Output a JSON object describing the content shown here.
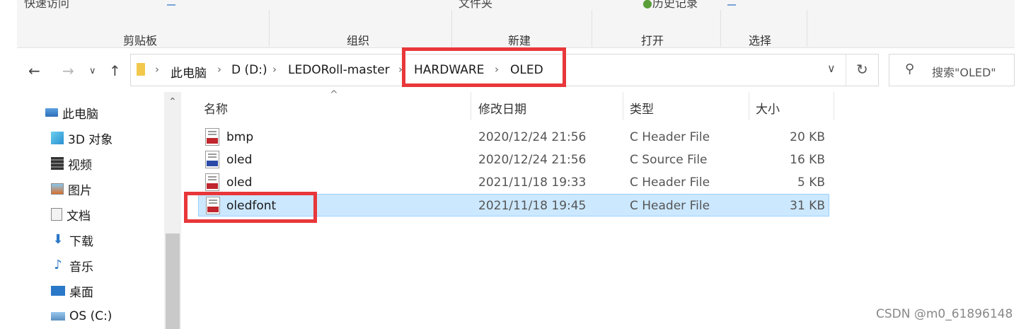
{
  "ribbon": {
    "top_left": "快速访问",
    "top_mid": "文件夹",
    "top_right": "历史记录",
    "groups": [
      "剪贴板",
      "组织",
      "新建",
      "打开",
      "选择"
    ]
  },
  "address": {
    "crumbs": [
      "此电脑",
      "D (D:)",
      "LEDORoll-master",
      "HARDWARE",
      "OLED"
    ],
    "separator": "›"
  },
  "search": {
    "placeholder": "搜索\"OLED\""
  },
  "nav": {
    "items": [
      {
        "label": "此电脑"
      },
      {
        "label": "3D 对象"
      },
      {
        "label": "视频"
      },
      {
        "label": "图片"
      },
      {
        "label": "文档"
      },
      {
        "label": "下载"
      },
      {
        "label": "音乐"
      },
      {
        "label": "桌面"
      },
      {
        "label": "OS (C:)"
      }
    ]
  },
  "columns": {
    "name": "名称",
    "date": "修改日期",
    "type": "类型",
    "size": "大小"
  },
  "files": [
    {
      "name": "bmp",
      "date": "2020/12/24 21:56",
      "type": "C Header File",
      "size": "20 KB"
    },
    {
      "name": "oled",
      "date": "2020/12/24 21:56",
      "type": "C Source File",
      "size": "16 KB"
    },
    {
      "name": "oled",
      "date": "2021/11/18 19:33",
      "type": "C Header File",
      "size": "5 KB"
    },
    {
      "name": "oledfont",
      "date": "2021/11/18 19:45",
      "type": "C Header File",
      "size": "31 KB"
    }
  ],
  "watermark": "CSDN @m0_61896148",
  "colors": {
    "highlight": "#e8373a",
    "selection": "#cce8ff"
  }
}
